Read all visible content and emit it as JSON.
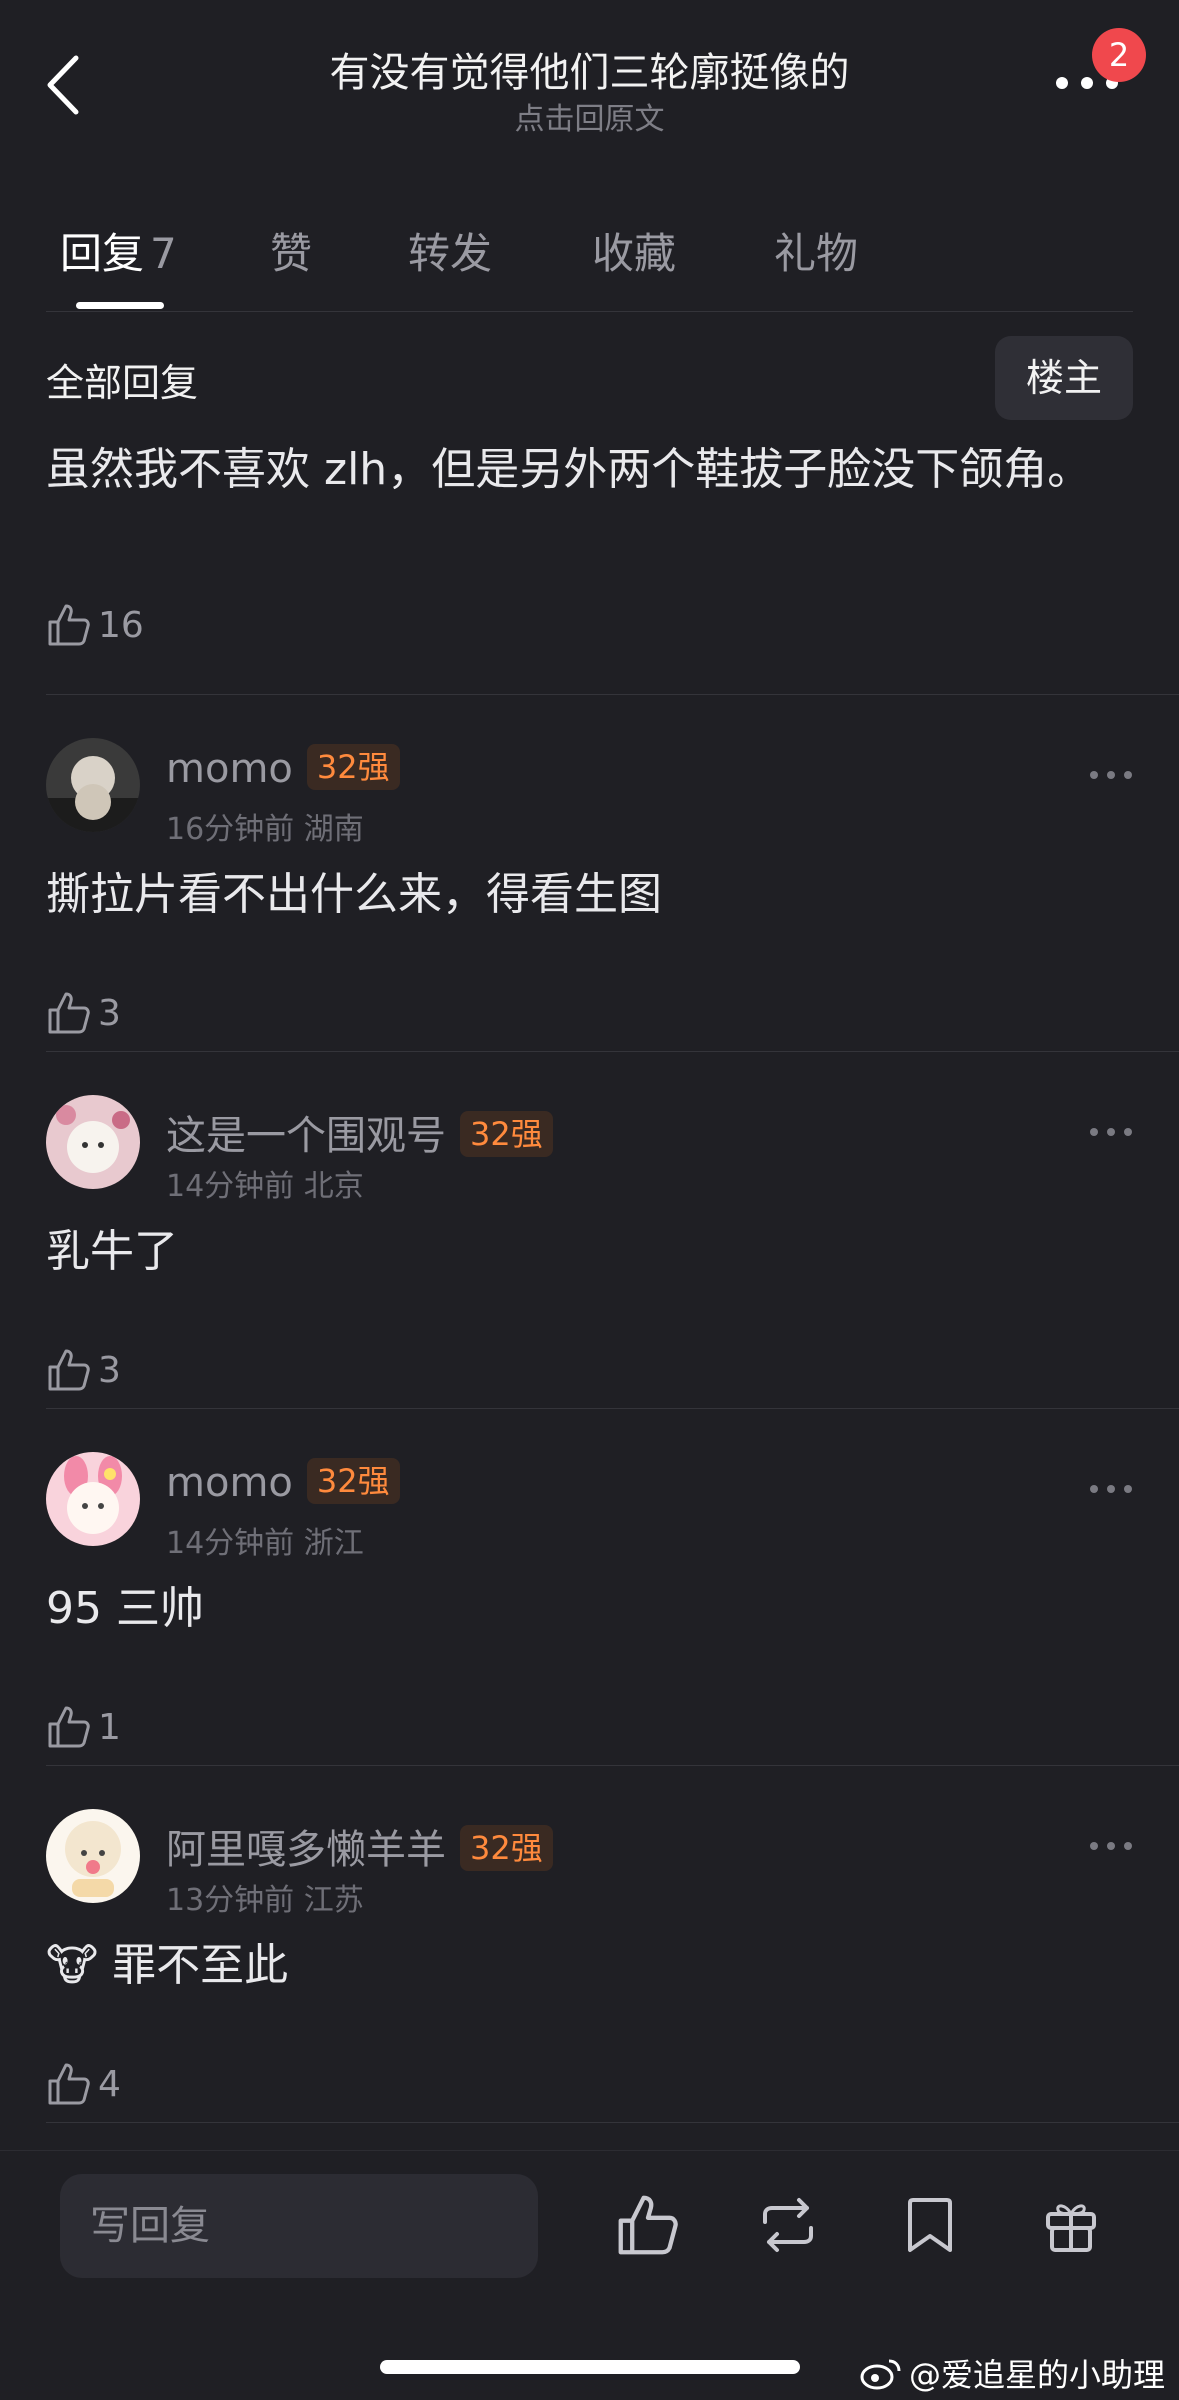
{
  "header": {
    "title": "有没有觉得他们三轮廓挺像的",
    "subtitle": "点击回原文",
    "badge_count": "2"
  },
  "tabs": [
    {
      "label": "回复",
      "count": "7",
      "active": true
    },
    {
      "label": "赞"
    },
    {
      "label": "转发"
    },
    {
      "label": "收藏"
    },
    {
      "label": "礼物"
    }
  ],
  "section": {
    "title": "全部回复",
    "op_button": "楼主"
  },
  "main_comment": {
    "text": "虽然我不喜欢 zlh，但是另外两个鞋拔子脸没下颌角。",
    "likes": "16"
  },
  "comments": [
    {
      "name": "momo",
      "level": "32强",
      "time": "16分钟前",
      "location": "湖南",
      "text": "撕拉片看不出什么来，得看生图",
      "likes": "3"
    },
    {
      "name": "这是一个围观号",
      "level": "32强",
      "time": "14分钟前",
      "location": "北京",
      "text": "乳牛了",
      "likes": "3"
    },
    {
      "name": "momo",
      "level": "32强",
      "time": "14分钟前",
      "location": "浙江",
      "text": "95 三帅",
      "likes": "1"
    },
    {
      "name": "阿里嘎多懒羊羊",
      "level": "32强",
      "time": "13分钟前",
      "location": "江苏",
      "text": "🐮 罪不至此",
      "likes": "4"
    }
  ],
  "bottom_bar": {
    "reply_placeholder": "写回复"
  },
  "watermark": "@爱追星的小助理",
  "colors": {
    "background": "#1f1f24",
    "badge": "#f0484d",
    "level_text": "#ff8a3d",
    "level_bg": "#3a2a22"
  }
}
